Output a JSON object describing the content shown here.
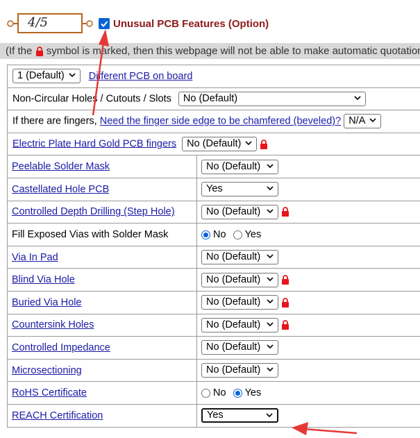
{
  "header": {
    "step": "4/5",
    "checkbox_checked": true,
    "title": "Unusual PCB Features (Option)"
  },
  "notice": {
    "before": "(If the",
    "after": "symbol is marked, then this webpage will not be able to make automatic quotation"
  },
  "rows": {
    "boards": {
      "value": "1 (Default)",
      "link": "Different PCB on board"
    },
    "holes": {
      "label": "Non-Circular Holes / Cutouts / Slots",
      "value": "No (Default)"
    },
    "fingers": {
      "label": "If there are fingers,",
      "link": "Need the finger side edge to be chamfered (beveled)?",
      "value": "N/A"
    },
    "gold": {
      "label": "Electric Plate Hard Gold PCB fingers",
      "value": "No (Default)",
      "locked": true
    },
    "peelable": {
      "label": "Peelable Solder Mask",
      "value": "No (Default)"
    },
    "castellated": {
      "label": "Castellated Hole PCB",
      "value": "Yes"
    },
    "depth": {
      "label": "Controlled Depth Drilling (Step Hole)",
      "value": "No (Default)",
      "locked": true
    },
    "fill_vias": {
      "label": "Fill Exposed Vias with Solder Mask",
      "opt_no": "No",
      "opt_yes": "Yes",
      "selected": "No"
    },
    "via_in_pad": {
      "label": "Via In Pad",
      "value": "No (Default)"
    },
    "blind": {
      "label": "Blind Via Hole",
      "value": "No (Default)",
      "locked": true
    },
    "buried": {
      "label": "Buried Via Hole",
      "value": "No (Default)",
      "locked": true
    },
    "countersink": {
      "label": "Countersink Holes",
      "value": "No (Default)",
      "locked": true
    },
    "impedance": {
      "label": "Controlled Impedance",
      "value": "No (Default)"
    },
    "microsection": {
      "label": "Microsectioning",
      "value": "No (Default)"
    },
    "rohs": {
      "label": "RoHS Certificate",
      "opt_no": "No",
      "opt_yes": "Yes",
      "selected": "Yes"
    },
    "reach": {
      "label": "REACH Certification",
      "value": "Yes"
    }
  },
  "colors": {
    "link": "#1a1aa6",
    "title": "#8b1a1a",
    "lock": "#e8141b",
    "annotation_arrow": "#e53935",
    "checkbox": "#0a63d6"
  }
}
